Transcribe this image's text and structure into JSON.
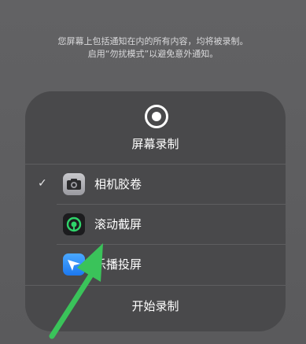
{
  "notice": {
    "line1": "您屏幕上包括通知在内的所有内容，均将被录制。",
    "line2": "启用“勿扰模式”以避免意外通知。"
  },
  "panel": {
    "title": "屏幕录制",
    "record_icon": "record-icon",
    "options": [
      {
        "label": "相机胶卷",
        "icon": "camera-roll-icon",
        "selected": true,
        "check": "✓"
      },
      {
        "label": "滚动截屏",
        "icon": "scroll-screenshot-icon",
        "selected": false
      },
      {
        "label": "乐播投屏",
        "icon": "cast-icon",
        "selected": false
      }
    ],
    "start_label": "开始录制"
  },
  "colors": {
    "background": "#5c5c5e",
    "panel": "#49494b",
    "annotation_arrow": "#3ac35a"
  }
}
